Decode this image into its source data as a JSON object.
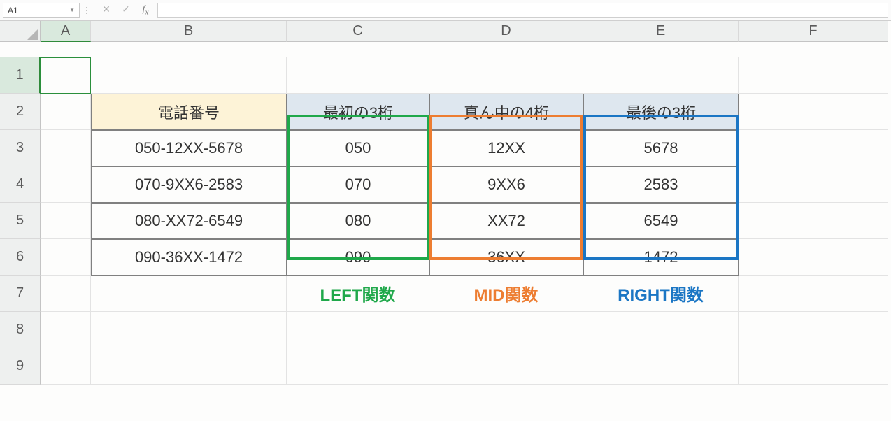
{
  "formula_bar": {
    "cell_reference": "A1",
    "formula_value": ""
  },
  "columns": [
    "A",
    "B",
    "C",
    "D",
    "E",
    "F"
  ],
  "rows": [
    "1",
    "2",
    "3",
    "4",
    "5",
    "6",
    "7",
    "8",
    "9"
  ],
  "table": {
    "headers": {
      "phone": "電話番号",
      "first3": "最初の3桁",
      "mid4": "真ん中の4桁",
      "last3": "最後の3桁"
    },
    "data": [
      {
        "phone": "050-12XX-5678",
        "first3": "050",
        "mid4": "12XX",
        "last3": "5678"
      },
      {
        "phone": "070-9XX6-2583",
        "first3": "070",
        "mid4": "9XX6",
        "last3": "2583"
      },
      {
        "phone": "080-XX72-6549",
        "first3": "080",
        "mid4": "XX72",
        "last3": "6549"
      },
      {
        "phone": "090-36XX-1472",
        "first3": "090",
        "mid4": "36XX",
        "last3": "1472"
      }
    ],
    "function_labels": {
      "left": "LEFT関数",
      "mid": "MID関数",
      "right": "RIGHT関数"
    }
  },
  "colors": {
    "left_outline": "#1fa84a",
    "mid_outline": "#ed7d31",
    "right_outline": "#1b76c4"
  },
  "active_cell": "A1"
}
